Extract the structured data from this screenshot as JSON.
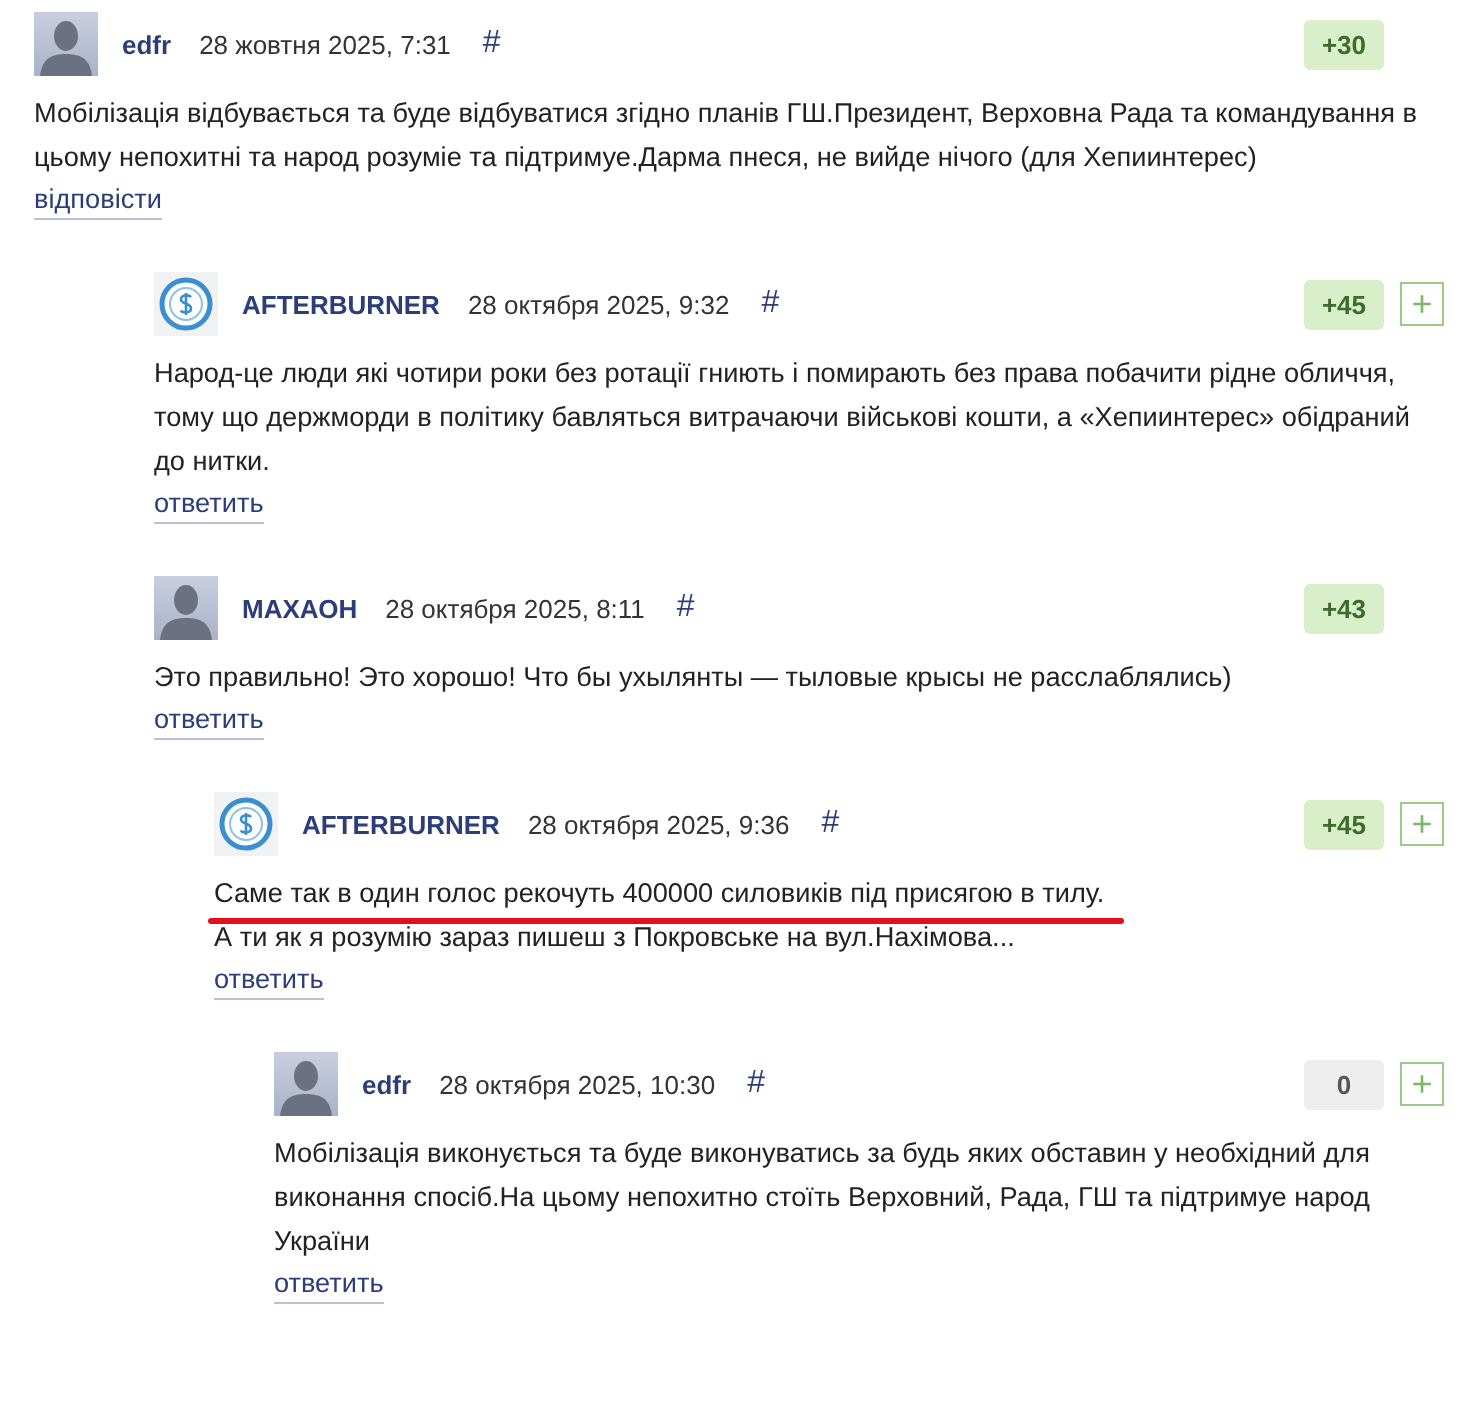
{
  "comments": [
    {
      "avatar": {
        "kind": "silhouette"
      },
      "author": "edfr",
      "date": "28 жовтня 2025, 7:31",
      "anchor": "#",
      "score": {
        "text": "+30",
        "kind": "positive"
      },
      "body": [
        {
          "text": "Мобілізація відбувається та буде відбуватися згідно планів ГШ.Президент, Верховна Рада та командування в цьому непохитні та народ розуміе та підтримуе.Дарма пнеся, не вийде нічого (для Хепиинтерес)",
          "underlined": false
        }
      ],
      "reply": "відповісти",
      "children": [
        {
          "avatar": {
            "kind": "coin"
          },
          "author": "AFTERBURNER",
          "date": "28 октября 2025, 9:32",
          "anchor": "#",
          "score": {
            "text": "+45",
            "kind": "positive"
          },
          "vote_button": "+",
          "body": [
            {
              "text": "Народ-це люди які чотири роки без ротації гниють і помирають без права побачити рідне обличчя, тому що держморди в політику бавляться витрачаючи військові кошти, а «Хепиинтерес» обідраний до нитки.",
              "underlined": false
            }
          ],
          "reply": "ответить"
        },
        {
          "avatar": {
            "kind": "silhouette"
          },
          "author": "МАХАОН",
          "date": "28 октября 2025, 8:11",
          "anchor": "#",
          "score": {
            "text": "+43",
            "kind": "positive"
          },
          "body": [
            {
              "text": "Это правильно! Это хорошо! Что бы ухылянты — тыловые крысы не расслаблялись)",
              "underlined": false
            }
          ],
          "reply": "ответить",
          "children": [
            {
              "avatar": {
                "kind": "coin"
              },
              "author": "AFTERBURNER",
              "date": "28 октября 2025, 9:36",
              "anchor": "#",
              "score": {
                "text": "+45",
                "kind": "positive"
              },
              "vote_button": "+",
              "body": [
                {
                  "text": "Саме так в один голос рекочуть 400000 силовиків під присягою в тилу.",
                  "underlined": true
                },
                {
                  "text": "А ти як я розумію зараз пишеш з Покровське на вул.Нахімова...",
                  "underlined": false
                }
              ],
              "reply": "ответить",
              "children": [
                {
                  "avatar": {
                    "kind": "silhouette"
                  },
                  "author": "edfr",
                  "date": "28 октября 2025, 10:30",
                  "anchor": "#",
                  "score": {
                    "text": "0",
                    "kind": "zero"
                  },
                  "vote_button": "+",
                  "body": [
                    {
                      "text": "Мобілізація виконується та буде виконуватись за будь яких обставин у необхідний для виконання спосіб.На цьому непохитно стоїть Верховний, Рада, ГШ та підтримуе народ України",
                      "underlined": false
                    }
                  ],
                  "reply": "ответить"
                }
              ]
            }
          ]
        }
      ]
    }
  ]
}
